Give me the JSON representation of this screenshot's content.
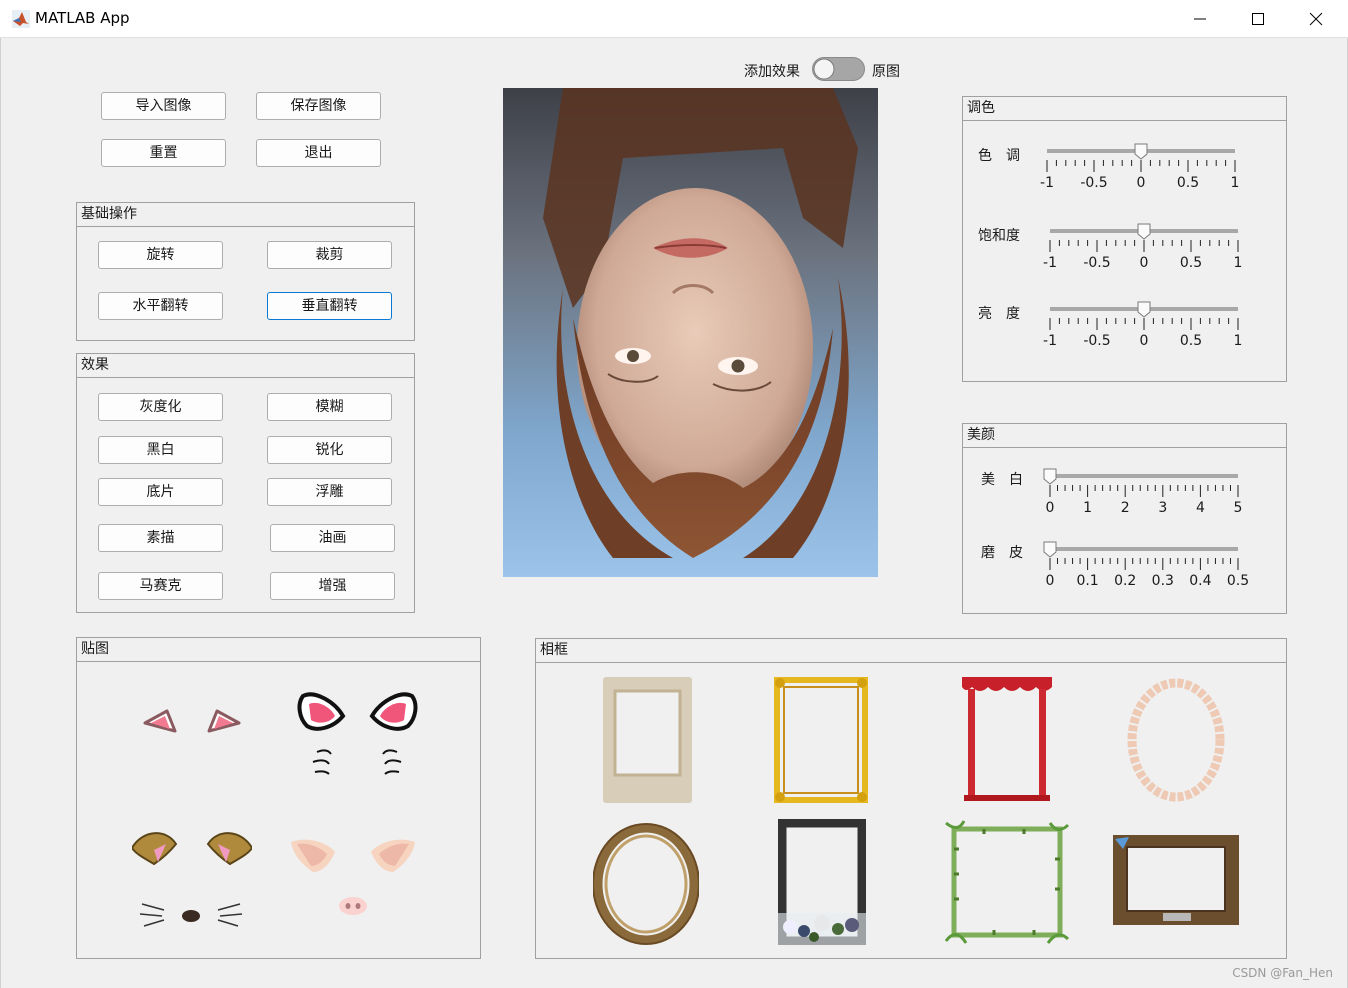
{
  "window": {
    "title": "MATLAB App",
    "controls": [
      "minimize",
      "maximize",
      "close"
    ]
  },
  "toggle": {
    "left_label": "添加效果",
    "right_label": "原图",
    "state": "off"
  },
  "top_buttons": {
    "import": "导入图像",
    "save": "保存图像",
    "reset": "重置",
    "exit": "退出"
  },
  "basic_ops": {
    "title": "基础操作",
    "rotate": "旋转",
    "crop": "裁剪",
    "hflip": "水平翻转",
    "vflip": "垂直翻转"
  },
  "effects": {
    "title": "效果",
    "gray": "灰度化",
    "blur": "模糊",
    "bw": "黑白",
    "sharpen": "锐化",
    "negative": "底片",
    "emboss": "浮雕",
    "sketch": "素描",
    "oil": "油画",
    "mosaic": "马赛克",
    "enhance": "增强"
  },
  "color_adjust": {
    "title": "调色",
    "hue": {
      "label": "色　调",
      "value": 0,
      "ticks": [
        "-1",
        "-0.5",
        "0",
        "0.5",
        "1"
      ]
    },
    "saturation": {
      "label": "饱和度",
      "value": 0,
      "ticks": [
        "-1",
        "-0.5",
        "0",
        "0.5",
        "1"
      ]
    },
    "brightness": {
      "label": "亮　度",
      "value": 0,
      "ticks": [
        "-1",
        "-0.5",
        "0",
        "0.5",
        "1"
      ]
    }
  },
  "beauty": {
    "title": "美颜",
    "whiten": {
      "label": "美　白",
      "value": 0,
      "ticks": [
        "0",
        "1",
        "2",
        "3",
        "4",
        "5"
      ]
    },
    "smooth": {
      "label": "磨　皮",
      "value": 0,
      "ticks": [
        "0",
        "0.1",
        "0.2",
        "0.3",
        "0.4",
        "0.5"
      ]
    }
  },
  "stickers": {
    "title": "贴图",
    "items": [
      "pink-ears-sticker",
      "cat-ears-whiskers-sticker",
      "dog-ears-nose-sticker",
      "pig-ears-nose-sticker"
    ]
  },
  "frames": {
    "title": "相框",
    "items": [
      "vintage-paper-frame",
      "gold-ornate-frame",
      "red-curtain-frame",
      "peach-oval-frame",
      "bronze-oval-frame",
      "black-floral-frame",
      "bamboo-frame",
      "wooden-plaque-frame"
    ]
  },
  "image_preview": "upside-down-portrait-photo",
  "watermark": "CSDN @Fan_Hen"
}
